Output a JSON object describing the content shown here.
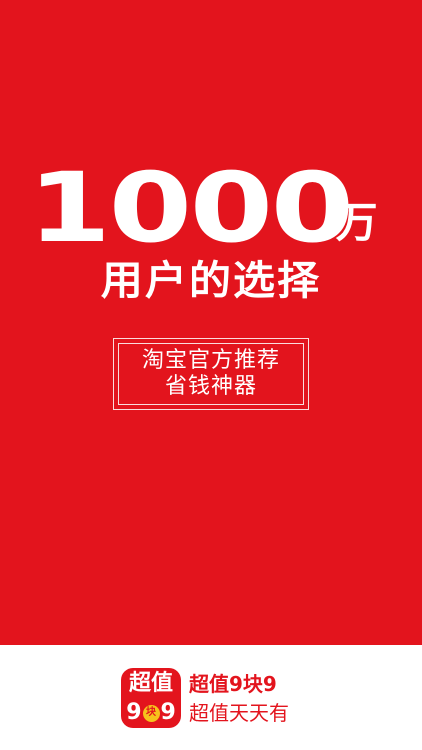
{
  "headline": {
    "number": "1000",
    "unit": "万",
    "subtitle": "用户的选择"
  },
  "tagline": {
    "line1": "淘宝官方推荐",
    "line2": "省钱神器"
  },
  "app": {
    "icon_top": "超值",
    "icon_digit_left": "9",
    "icon_coin": "块",
    "icon_digit_right": "9",
    "name": "超值9块9",
    "slogan": "超值天天有"
  },
  "colors": {
    "brand_red": "#e3141d",
    "coin_yellow": "#f6c21c"
  }
}
